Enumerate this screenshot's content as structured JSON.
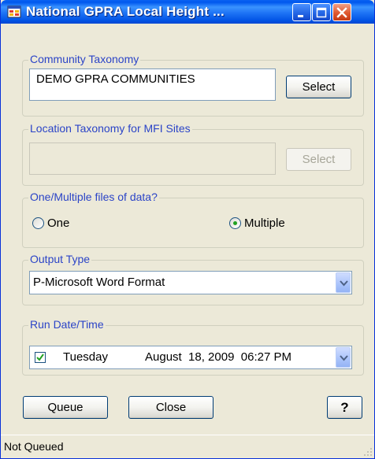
{
  "window": {
    "title": "National GPRA Local Height ...",
    "controls": {
      "minimize": "minimize",
      "maximize": "maximize",
      "close": "close"
    }
  },
  "community_taxonomy": {
    "legend": "Community Taxonomy",
    "value": "DEMO GPRA COMMUNITIES",
    "select_label": "Select"
  },
  "location_taxonomy": {
    "legend": "Location Taxonomy for MFI Sites",
    "value": "",
    "select_label": "Select",
    "enabled": false
  },
  "files": {
    "legend": "One/Multiple files of data?",
    "options": [
      {
        "label": "One",
        "selected": false
      },
      {
        "label": "Multiple",
        "selected": true
      }
    ]
  },
  "output_type": {
    "legend": "Output Type",
    "selected": "P-Microsoft Word Format"
  },
  "run_date": {
    "legend": "Run Date/Time",
    "checked": true,
    "weekday": "Tuesday",
    "date": "August  18, 2009  06:27 PM"
  },
  "buttons": {
    "queue": "Queue",
    "close": "Close",
    "help": "?"
  },
  "status": {
    "text": "Not Queued"
  },
  "colors": {
    "title_bar": "#0058ee",
    "legend_text": "#2b44c7",
    "window_bg": "#ece9d8",
    "radio_dot": "#21a121"
  }
}
